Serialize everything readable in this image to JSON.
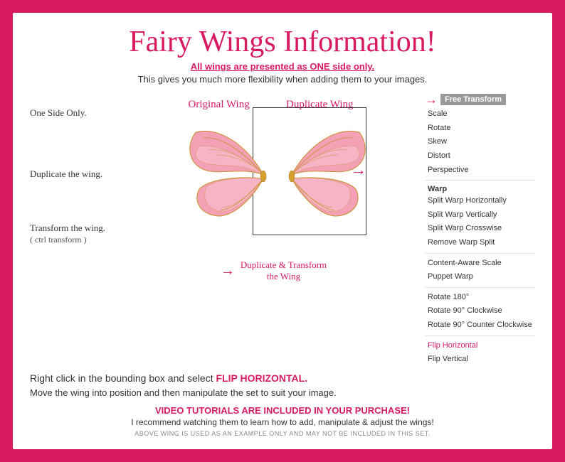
{
  "outer": {
    "bg_color": "#d81b60"
  },
  "header": {
    "title": "Fairy Wings Information!",
    "subtitle_1": "All wings are presented as ",
    "subtitle_1_bold": "ONE",
    "subtitle_1_end": " side only.",
    "subtitle_2": "This gives you much more flexibility when adding them to your images."
  },
  "steps": {
    "one": "One Side Only.",
    "two": "Duplicate the wing.",
    "three": "Transform the wing.",
    "three_sub": "( ctrl transform )"
  },
  "wing_labels": {
    "original": "Original Wing",
    "duplicate": "Duplicate Wing",
    "bottom": "Duplicate & Transform\n the Wing"
  },
  "right_panel": {
    "free_transform_label": "Free Transform",
    "items": [
      "Scale",
      "Rotate",
      "Skew",
      "Distort",
      "Perspective"
    ],
    "warp_label": "Warp",
    "warp_items": [
      "Split Warp Horizontally",
      "Split Warp Vertically",
      "Split Warp Crosswise",
      "Remove Warp Split"
    ],
    "other_items": [
      "Content-Aware Scale",
      "Puppet Warp"
    ],
    "rotate_items": [
      "Rotate 180°",
      "Rotate 90° Clockwise",
      "Rotate 90° Counter Clockwise"
    ],
    "flip_items": [
      "Flip Horizontal",
      "Flip Vertical"
    ]
  },
  "bottom": {
    "flip_instruction_pre": "Right click in the bounding box and select ",
    "flip_instruction_bold": "FLIP HORIZONTAL.",
    "move_instruction": "Move the wing into position and then manipulate the set to\nsuit your image.",
    "video_text": "VIDEO TUTORIALS ARE INCLUDED IN YOUR PURCHASE!",
    "recommend_text": "I recommend watching them to learn how to add, manipulate & adjust the wings!",
    "fine_print": "ABOVE WING IS USED AS AN EXAMPLE ONLY AND MAY NOT BE INCLUDED IN THIS SET."
  }
}
